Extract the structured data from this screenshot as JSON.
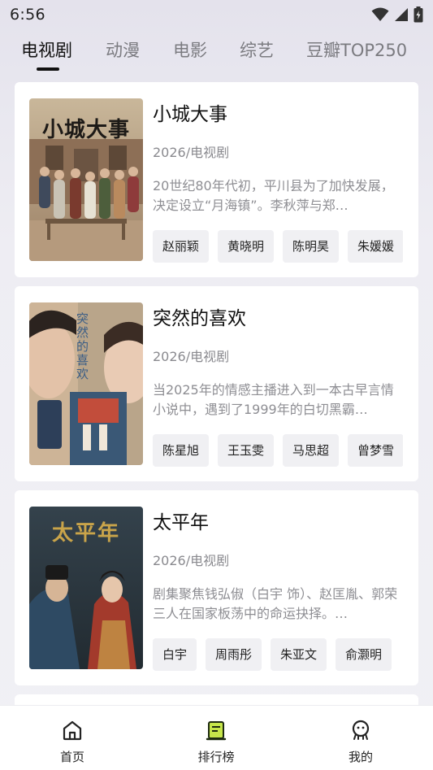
{
  "status_bar": {
    "time": "6:56",
    "icons": [
      "wifi-icon",
      "signal-icon",
      "battery-charging-icon"
    ]
  },
  "tabs": [
    {
      "label": "电视剧",
      "active": true
    },
    {
      "label": "动漫",
      "active": false
    },
    {
      "label": "电影",
      "active": false
    },
    {
      "label": "综艺",
      "active": false
    },
    {
      "label": "豆瓣TOP250",
      "active": false
    }
  ],
  "shows": [
    {
      "title": "小城大事",
      "meta": "2026/电视剧",
      "description": "20世纪80年代初，平川县为了加快发展，决定设立“月海镇”。李秋萍与郑…",
      "cast": [
        "赵丽颖",
        "黄晓明",
        "陈明昊",
        "朱媛媛"
      ],
      "poster_text": "小城大事"
    },
    {
      "title": "突然的喜欢",
      "meta": "2026/电视剧",
      "description": "当2025年的情感主播进入到一本古早言情小说中，遇到了1999年的白切黑霸…",
      "cast": [
        "陈星旭",
        "王玉雯",
        "马思超",
        "曾梦雪"
      ],
      "poster_text": "突然的喜欢"
    },
    {
      "title": "太平年",
      "meta": "2026/电视剧",
      "description": "剧集聚焦钱弘俶（白宇 饰）、赵匡胤、郭荣三人在国家板荡中的命运抉择。…",
      "cast": [
        "白宇",
        "周雨彤",
        "朱亚文",
        "俞灏明"
      ],
      "poster_text": "太平年"
    }
  ],
  "bottom_nav": [
    {
      "label": "首页",
      "icon": "home-icon"
    },
    {
      "label": "排行榜",
      "icon": "ranking-icon"
    },
    {
      "label": "我的",
      "icon": "profile-icon"
    }
  ],
  "colors": {
    "accent": "#c6e64a",
    "text_primary": "#111111",
    "text_secondary": "#8a8a8f",
    "card_bg": "#ffffff",
    "tag_bg": "#f0f0f3"
  }
}
